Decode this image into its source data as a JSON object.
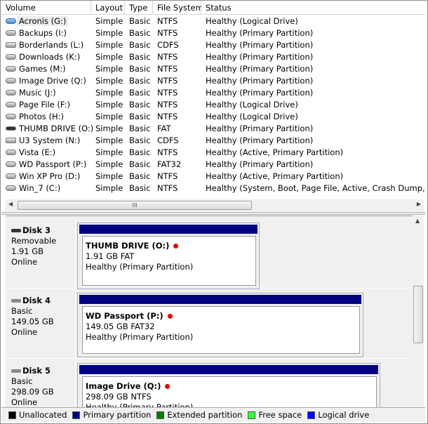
{
  "columns": [
    "Volume",
    "Layout",
    "Type",
    "File System",
    "Status"
  ],
  "volumes": [
    {
      "name": "Acronis (G:)",
      "layout": "Simple",
      "type": "Basic",
      "fs": "NTFS",
      "status": "Healthy (Logical Drive)",
      "icon": "disk-blue-icon"
    },
    {
      "name": "Backups (I:)",
      "layout": "Simple",
      "type": "Basic",
      "fs": "NTFS",
      "status": "Healthy (Primary Partition)",
      "icon": "disk-icon"
    },
    {
      "name": "Borderlands (L:)",
      "layout": "Simple",
      "type": "Basic",
      "fs": "CDFS",
      "status": "Healthy (Primary Partition)",
      "icon": "cd-drive-icon"
    },
    {
      "name": "Downloads (K:)",
      "layout": "Simple",
      "type": "Basic",
      "fs": "NTFS",
      "status": "Healthy (Primary Partition)",
      "icon": "disk-icon"
    },
    {
      "name": "Games (M:)",
      "layout": "Simple",
      "type": "Basic",
      "fs": "NTFS",
      "status": "Healthy (Primary Partition)",
      "icon": "disk-icon"
    },
    {
      "name": "Image Drive (Q:)",
      "layout": "Simple",
      "type": "Basic",
      "fs": "NTFS",
      "status": "Healthy (Primary Partition)",
      "icon": "disk-icon"
    },
    {
      "name": "Music (J:)",
      "layout": "Simple",
      "type": "Basic",
      "fs": "NTFS",
      "status": "Healthy (Primary Partition)",
      "icon": "disk-icon"
    },
    {
      "name": "Page File (F:)",
      "layout": "Simple",
      "type": "Basic",
      "fs": "NTFS",
      "status": "Healthy (Logical Drive)",
      "icon": "disk-icon"
    },
    {
      "name": "Photos (H:)",
      "layout": "Simple",
      "type": "Basic",
      "fs": "NTFS",
      "status": "Healthy (Logical Drive)",
      "icon": "disk-icon"
    },
    {
      "name": "THUMB DRIVE (O:)",
      "layout": "Simple",
      "type": "Basic",
      "fs": "FAT",
      "status": "Healthy (Primary Partition)",
      "icon": "usb-drive-icon"
    },
    {
      "name": "U3 System (N:)",
      "layout": "Simple",
      "type": "Basic",
      "fs": "CDFS",
      "status": "Healthy (Primary Partition)",
      "icon": "cd-drive-icon"
    },
    {
      "name": "Vista (E:)",
      "layout": "Simple",
      "type": "Basic",
      "fs": "NTFS",
      "status": "Healthy (Active, Primary Partition)",
      "icon": "disk-icon"
    },
    {
      "name": "WD Passport (P:)",
      "layout": "Simple",
      "type": "Basic",
      "fs": "FAT32",
      "status": "Healthy (Primary Partition)",
      "icon": "disk-icon"
    },
    {
      "name": "Win XP Pro (D:)",
      "layout": "Simple",
      "type": "Basic",
      "fs": "NTFS",
      "status": "Healthy (Active, Primary Partition)",
      "icon": "disk-icon"
    },
    {
      "name": "Win_7 (C:)",
      "layout": "Simple",
      "type": "Basic",
      "fs": "NTFS",
      "status": "Healthy (System, Boot, Page File, Active, Crash Dump, Primary Partition)",
      "icon": "disk-icon"
    }
  ],
  "scroll_grip": "III",
  "disks": [
    {
      "name": "Disk 3",
      "kind": "Removable",
      "size": "1.91 GB",
      "state": "Online",
      "part": {
        "label": "THUMB DRIVE  (O:)",
        "size": "1.91 GB FAT",
        "status": "Healthy (Primary Partition)"
      }
    },
    {
      "name": "Disk 4",
      "kind": "Basic",
      "size": "149.05 GB",
      "state": "Online",
      "part": {
        "label": "WD Passport  (P:)",
        "size": "149.05 GB FAT32",
        "status": "Healthy (Primary Partition)"
      }
    },
    {
      "name": "Disk 5",
      "kind": "Basic",
      "size": "298.09 GB",
      "state": "Online",
      "part": {
        "label": "Image Drive  (Q:)",
        "size": "298.09 GB NTFS",
        "status": "Healthy (Primary Partition)"
      }
    }
  ],
  "legend": [
    {
      "label": "Unallocated",
      "color": "#000000"
    },
    {
      "label": "Primary partition",
      "color": "#000080"
    },
    {
      "label": "Extended partition",
      "color": "#008000"
    },
    {
      "label": "Free space",
      "color": "#33ff33"
    },
    {
      "label": "Logical drive",
      "color": "#0000ff"
    }
  ]
}
